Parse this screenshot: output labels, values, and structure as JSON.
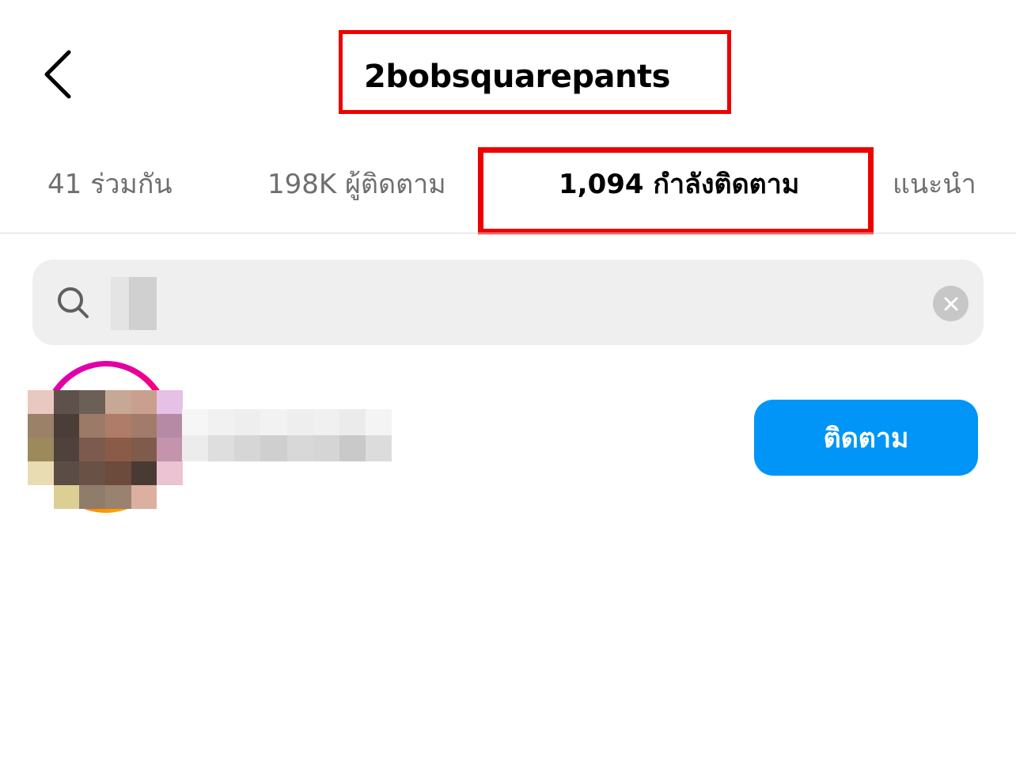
{
  "header": {
    "title": "2bobsquarepants"
  },
  "tabs": [
    {
      "label": "41 ร่วมกัน",
      "active": false
    },
    {
      "label": "198K ผู้ติดตาม",
      "active": false
    },
    {
      "label": "1,094 กำลังติดตาม",
      "active": true
    },
    {
      "label": "แนะนำ",
      "active": false
    }
  ],
  "search": {
    "value": "",
    "placeholder": ""
  },
  "result": {
    "follow_label": "ติดตาม"
  },
  "colors": {
    "follow_button": "#0095f6",
    "highlight_box": "#ee0000",
    "search_background": "#efefef",
    "inactive_tab_text": "#6f6f6f"
  },
  "icons": {
    "back": "chevron-left-icon",
    "search": "search-icon",
    "clear": "close-icon"
  }
}
